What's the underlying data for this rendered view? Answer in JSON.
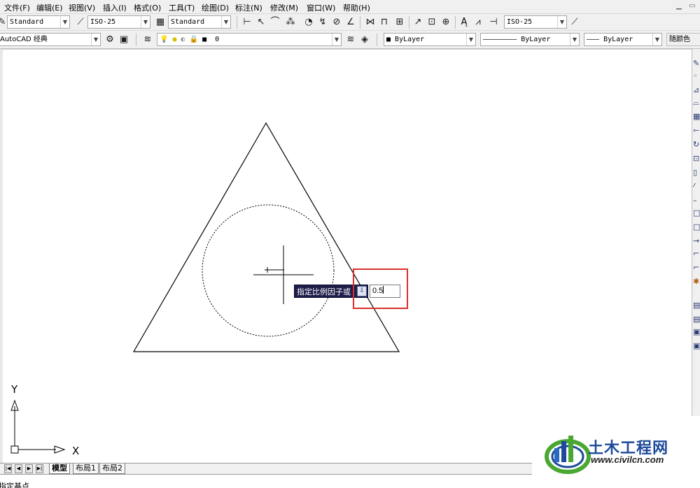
{
  "menu": [
    "文件(F)",
    "编辑(E)",
    "视图(V)",
    "插入(I)",
    "格式(O)",
    "工具(T)",
    "绘图(D)",
    "标注(N)",
    "修改(M)",
    "窗口(W)",
    "帮助(H)"
  ],
  "toolbar1": {
    "text_style": "Standard",
    "dim_style": "ISO-25",
    "table_style": "Standard",
    "dim_style_2": "ISO-25"
  },
  "toolbar2": {
    "workspace": "AutoCAD 经典",
    "layer": "0",
    "color": "ByLayer",
    "linetype": "ByLayer",
    "lineweight": "ByLayer",
    "plot_style": "随颜色"
  },
  "dynamic_input": {
    "prompt": "指定比例因子或",
    "value": "0.5",
    "arrow_glyph": "⇩"
  },
  "ucs": {
    "x_label": "X",
    "y_label": "Y"
  },
  "layout_tabs": [
    "模型",
    "布局1",
    "布局2"
  ],
  "nav_buttons": [
    "|◀",
    "◀",
    "▶",
    "▶|"
  ],
  "command_line": "指定基点",
  "watermark": {
    "title": "土木工程网",
    "url": "www.civilcn.com"
  },
  "colors": {
    "highlight": "#d9302c",
    "prompt_bg": "#1d1d4a",
    "watermark_blue": "#1d4a9a",
    "watermark_green": "#4aa832"
  },
  "toolbar_icons": [
    "properties-icon",
    "dim-linear-icon",
    "dim-aligned-icon",
    "dim-arc-icon",
    "dim-ordinate-icon",
    "dim-radius-icon",
    "dim-jogged-icon",
    "dim-diameter-icon",
    "dim-angular-icon",
    "quick-dim-icon",
    "dim-baseline-icon",
    "dim-continue-icon",
    "quick-leader-icon",
    "tolerance-icon",
    "center-mark-icon",
    "dim-edit-icon",
    "dim-text-edit-icon",
    "dim-update-icon",
    "layer-properties-icon",
    "lightbulb-icon",
    "sun-icon",
    "lock-icon",
    "layer-previous-icon",
    "layer-states-icon"
  ]
}
